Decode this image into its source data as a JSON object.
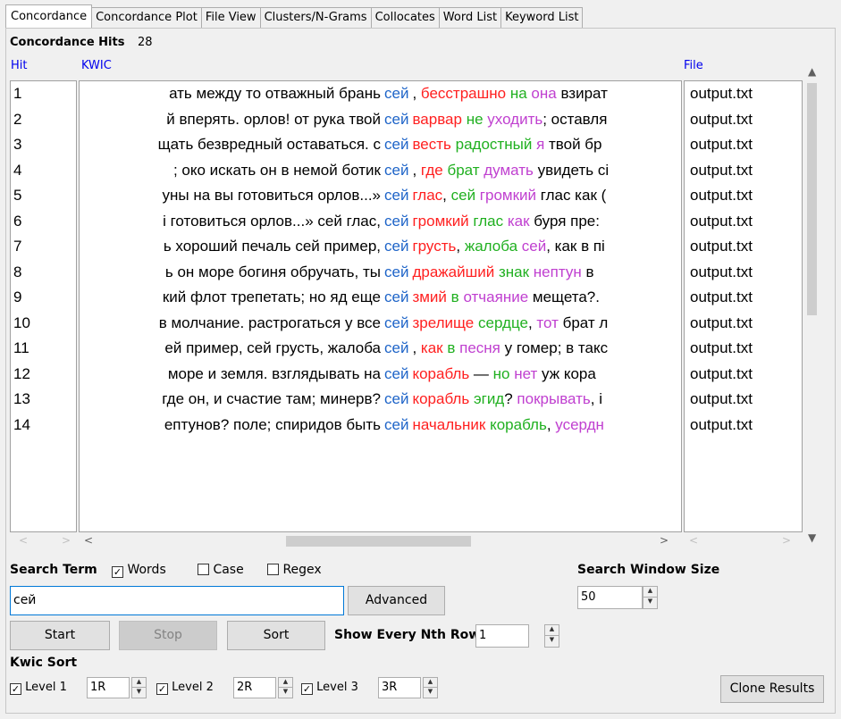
{
  "tabs": [
    {
      "label": "Concordance",
      "active": true
    },
    {
      "label": "Concordance Plot"
    },
    {
      "label": "File View"
    },
    {
      "label": "Clusters/N-Grams"
    },
    {
      "label": "Collocates"
    },
    {
      "label": "Word List"
    },
    {
      "label": "Keyword List"
    }
  ],
  "hits": {
    "label": "Concordance Hits",
    "count": "28"
  },
  "columns": {
    "hit": "Hit",
    "kwic": "KWIC",
    "file": "File"
  },
  "colors": {
    "node": "#1e64c8",
    "red": "#ff2020",
    "green": "#20b020",
    "purple": "#c040d0"
  },
  "rows": [
    {
      "hit": "1",
      "left": "ать между то отважный брань",
      "node": "сей",
      "right": [
        [
          "",
          ", "
        ],
        [
          "red",
          "бесстрашно"
        ],
        [
          "",
          " "
        ],
        [
          "green",
          "на"
        ],
        [
          "",
          " "
        ],
        [
          "purple",
          "она"
        ],
        [
          "",
          " взират"
        ]
      ],
      "file": "output.txt"
    },
    {
      "hit": "2",
      "left": "й вперять. орлов! от рука твой",
      "node": "сей",
      "right": [
        [
          "red",
          "варвар"
        ],
        [
          "",
          " "
        ],
        [
          "green",
          "не"
        ],
        [
          "",
          " "
        ],
        [
          "purple",
          "уходить"
        ],
        [
          "",
          "; оставля"
        ]
      ],
      "file": "output.txt"
    },
    {
      "hit": "3",
      "left": "щать безвредный оставаться. с",
      "node": "сей",
      "right": [
        [
          "red",
          "весть"
        ],
        [
          "",
          " "
        ],
        [
          "green",
          "радостный"
        ],
        [
          "",
          " "
        ],
        [
          "purple",
          "я"
        ],
        [
          "",
          " твой бр"
        ]
      ],
      "file": "output.txt"
    },
    {
      "hit": "4",
      "left": ";  око искать он в немой ботик",
      "node": "сей",
      "right": [
        [
          "",
          ", "
        ],
        [
          "red",
          "где"
        ],
        [
          "",
          " "
        ],
        [
          "green",
          "брат"
        ],
        [
          "",
          " "
        ],
        [
          "purple",
          "думать"
        ],
        [
          "",
          " увидеть сі"
        ]
      ],
      "file": "output.txt"
    },
    {
      "hit": "5",
      "left": "уны на вы готовиться орлов...»",
      "node": "сей",
      "right": [
        [
          "red",
          "глас"
        ],
        [
          "",
          ", "
        ],
        [
          "green",
          "сей"
        ],
        [
          "",
          " "
        ],
        [
          "purple",
          "громкий"
        ],
        [
          "",
          " глас как ("
        ]
      ],
      "file": "output.txt"
    },
    {
      "hit": "6",
      "left": "і готовиться орлов...»  сей глас,",
      "node": "сей",
      "right": [
        [
          "red",
          "громкий"
        ],
        [
          "",
          " "
        ],
        [
          "green",
          "глас"
        ],
        [
          "",
          " "
        ],
        [
          "purple",
          "как"
        ],
        [
          "",
          " буря пре:"
        ]
      ],
      "file": "output.txt"
    },
    {
      "hit": "7",
      "left": "ь хороший печаль сей пример,",
      "node": "сей",
      "right": [
        [
          "red",
          "грусть"
        ],
        [
          "",
          ", "
        ],
        [
          "green",
          "жалоба"
        ],
        [
          "",
          " "
        ],
        [
          "purple",
          "сей"
        ],
        [
          "",
          ", как в пі"
        ]
      ],
      "file": "output.txt"
    },
    {
      "hit": "8",
      "left": "ь он море богиня обручать, ты",
      "node": "сей",
      "right": [
        [
          "red",
          "дражайший"
        ],
        [
          "",
          " "
        ],
        [
          "green",
          "знак"
        ],
        [
          "",
          " "
        ],
        [
          "purple",
          "нептун"
        ],
        [
          "",
          " в"
        ]
      ],
      "file": "output.txt"
    },
    {
      "hit": "9",
      "left": "кий флот трепетать; но яд еще",
      "node": "сей",
      "right": [
        [
          "red",
          "змий"
        ],
        [
          "",
          " "
        ],
        [
          "green",
          "в"
        ],
        [
          "",
          " "
        ],
        [
          "purple",
          "отчаяние"
        ],
        [
          "",
          " мещета?."
        ]
      ],
      "file": "output.txt"
    },
    {
      "hit": "10",
      "left": "в молчание. растрогаться у все",
      "node": "сей",
      "right": [
        [
          "red",
          "зрелище"
        ],
        [
          "",
          " "
        ],
        [
          "green",
          "сердце"
        ],
        [
          "",
          ", "
        ],
        [
          "purple",
          "тот"
        ],
        [
          "",
          " брат л"
        ]
      ],
      "file": "output.txt"
    },
    {
      "hit": "11",
      "left": "ей пример, сей грусть, жалоба",
      "node": "сей",
      "right": [
        [
          "",
          ", "
        ],
        [
          "red",
          "как"
        ],
        [
          "",
          " "
        ],
        [
          "green",
          "в"
        ],
        [
          "",
          " "
        ],
        [
          "purple",
          "песня"
        ],
        [
          "",
          " у гомер; в такс"
        ]
      ],
      "file": "output.txt"
    },
    {
      "hit": "12",
      "left": "море и земля. взглядывать на",
      "node": "сей",
      "right": [
        [
          "red",
          "корабль"
        ],
        [
          "",
          " — "
        ],
        [
          "green",
          "но"
        ],
        [
          "",
          " "
        ],
        [
          "purple",
          "нет"
        ],
        [
          "",
          " уж кора"
        ]
      ],
      "file": "output.txt"
    },
    {
      "hit": "13",
      "left": "где он, и счастие там; минерв?",
      "node": "сей",
      "right": [
        [
          "red",
          "корабль"
        ],
        [
          "",
          " "
        ],
        [
          "green",
          "эгид"
        ],
        [
          "",
          "? "
        ],
        [
          "purple",
          "покрывать"
        ],
        [
          "",
          ", і"
        ]
      ],
      "file": "output.txt"
    },
    {
      "hit": "14",
      "left": "ептунов? поле;  спиридов быть",
      "node": "сей",
      "right": [
        [
          "red",
          "начальник"
        ],
        [
          "",
          " "
        ],
        [
          "green",
          "корабль"
        ],
        [
          "",
          ", "
        ],
        [
          "purple",
          "усердн"
        ]
      ],
      "file": "output.txt"
    }
  ],
  "search": {
    "term_label": "Search Term",
    "words_label": "Words",
    "words_checked": true,
    "case_label": "Case",
    "case_checked": false,
    "regex_label": "Regex",
    "regex_checked": false,
    "value": "сей",
    "advanced_label": "Advanced",
    "window_size_label": "Search Window Size",
    "window_size": "50"
  },
  "buttons": {
    "start": "Start",
    "stop": "Stop",
    "sort": "Sort",
    "clone": "Clone Results"
  },
  "nth": {
    "label": "Show Every Nth Row",
    "value": "1"
  },
  "kwic_sort": {
    "label": "Kwic Sort",
    "levels": [
      {
        "label": "Level 1",
        "value": "1R",
        "checked": true
      },
      {
        "label": "Level 2",
        "value": "2R",
        "checked": true
      },
      {
        "label": "Level 3",
        "value": "3R",
        "checked": true
      }
    ]
  }
}
